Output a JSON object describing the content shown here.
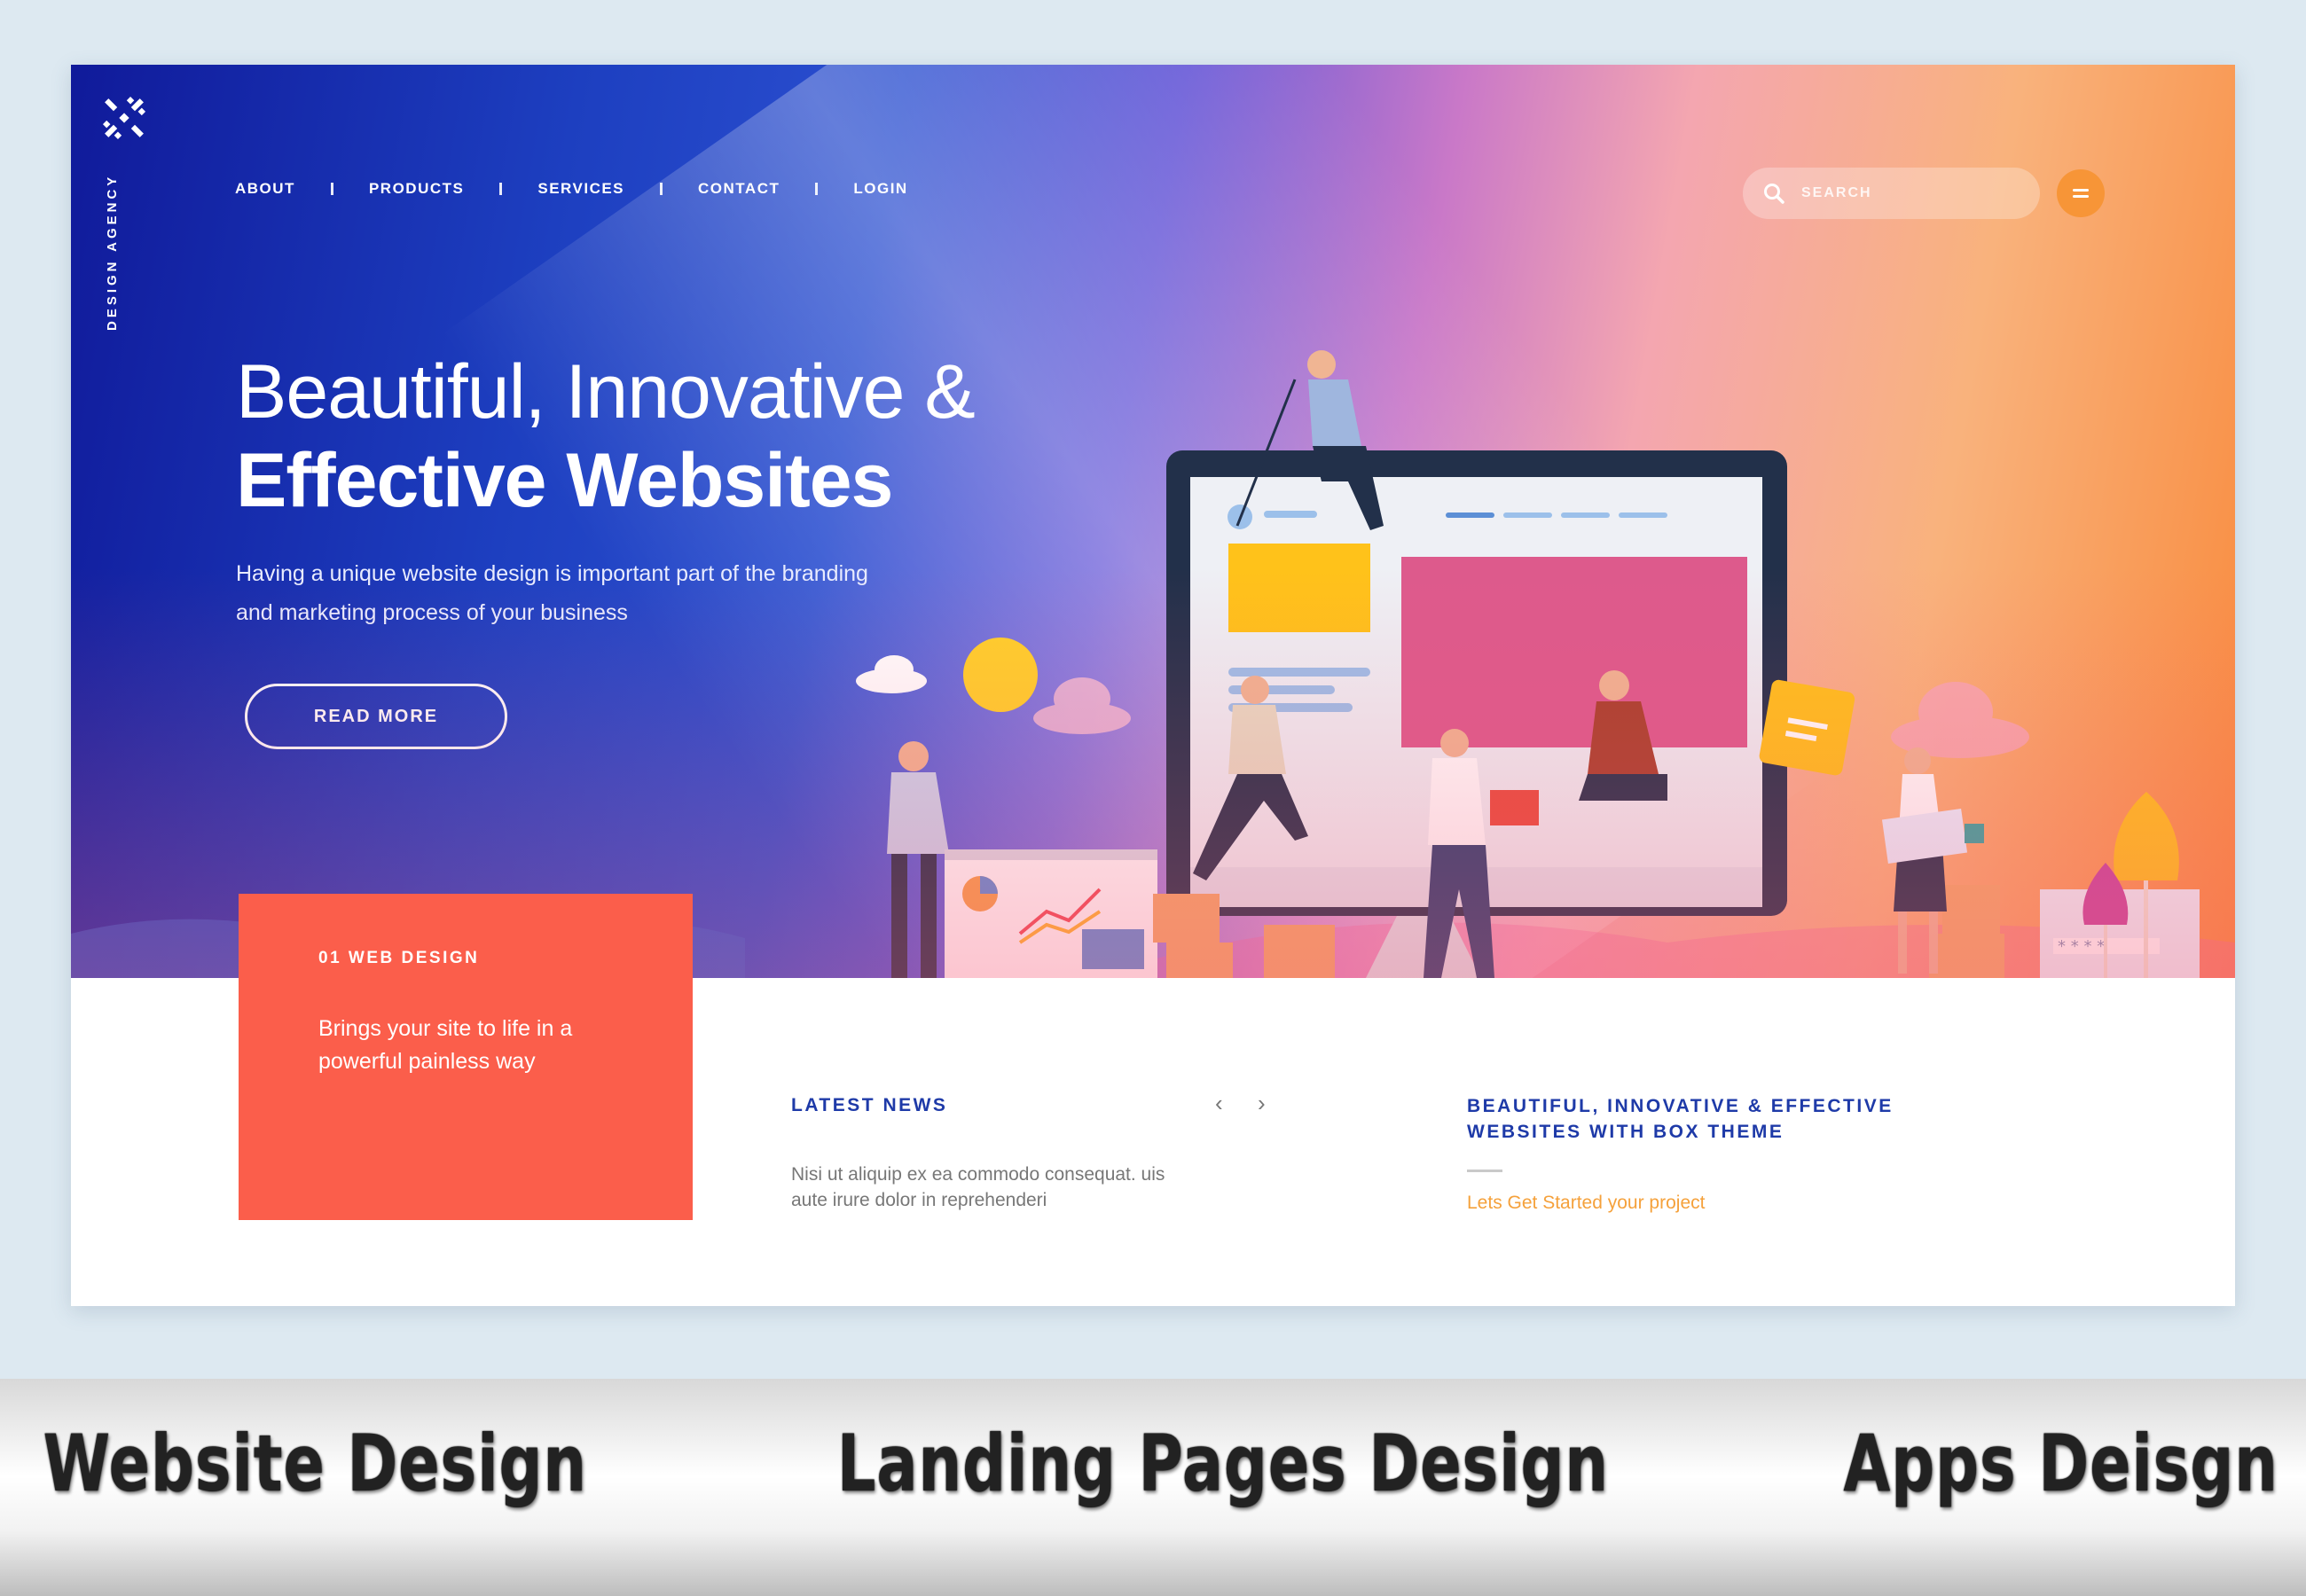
{
  "brand": {
    "logo_icon": "snowflake-cross-logo",
    "tagline": "DESIGN AGENCY"
  },
  "nav": {
    "items": [
      "ABOUT",
      "PRODUCTS",
      "SERVICES",
      "CONTACT",
      "LOGIN"
    ]
  },
  "search": {
    "placeholder": "SEARCH",
    "icon": "search-icon"
  },
  "menu": {
    "icon": "hamburger-icon",
    "color": "#f79537"
  },
  "hero": {
    "title_line1": "Beautiful, Innovative &",
    "title_line2": "Effective Websites",
    "subtitle": "Having a unique website design is important part of the branding and marketing process of your business",
    "cta": "READ MORE"
  },
  "feature_card": {
    "kicker": "01  WEB DESIGN",
    "description": "Brings your site to life in a powerful painless way",
    "color": "#fb5e4b"
  },
  "news": {
    "title": "LATEST NEWS",
    "prev_icon": "chevron-left-icon",
    "next_icon": "chevron-right-icon",
    "text": "Nisi ut aliquip ex ea commodo consequat. uis aute irure dolor in reprehenderi"
  },
  "box_theme": {
    "title": "BEAUTIFUL, INNOVATIVE & EFFECTIVE WEBSITES WITH BOX THEME",
    "link": "Lets Get Started your project",
    "link_color": "#f5a13b"
  },
  "banner": {
    "items": [
      "Website Design",
      "Landing Pages Design",
      "Apps Deisgn"
    ],
    "bullet_color": "#6ab516"
  },
  "colors": {
    "heading_blue": "#1e3aa8",
    "gradient_start": "#101a9a",
    "gradient_end": "#f98a3c"
  }
}
